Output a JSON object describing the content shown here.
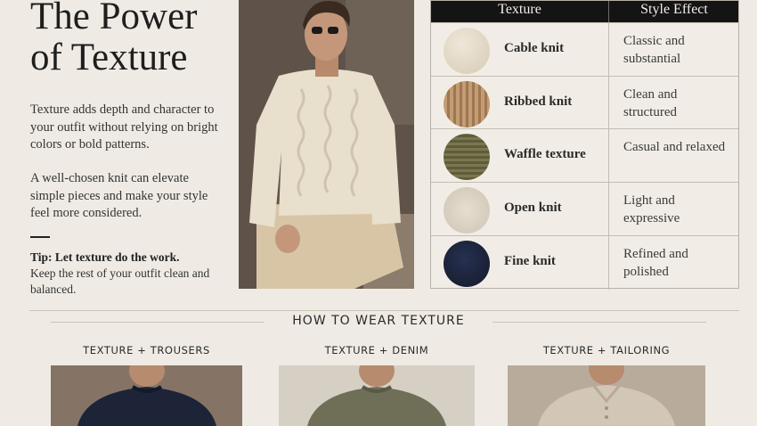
{
  "heading": {
    "line1": "The Power",
    "line2": "of Texture"
  },
  "intro": {
    "p1": "Texture adds depth and character to your outfit without relying on bright colors or bold patterns.",
    "p2": "A well-chosen knit can elevate simple pieces and make your style feel more considered."
  },
  "tip": {
    "label": "Tip: Let texture do the work.",
    "text": "Keep the rest of your outfit clean and balanced."
  },
  "table": {
    "header": {
      "col1": "Texture",
      "col2": "Style Effect"
    },
    "rows": [
      {
        "name": "Cable knit",
        "effect": "Classic and substantial",
        "swatch_color": "#e2d8c6"
      },
      {
        "name": "Ribbed knit",
        "effect": "Clean and structured",
        "swatch_color": "#b58d66"
      },
      {
        "name": "Waffle texture",
        "effect": "Casual and relaxed",
        "swatch_color": "#6e6a45"
      },
      {
        "name": "Open knit",
        "effect": "Light and expressive",
        "swatch_color": "#ddd3c5"
      },
      {
        "name": "Fine knit",
        "effect": "Refined and polished",
        "swatch_color": "#1b2235"
      }
    ]
  },
  "how_to": {
    "title": "HOW TO WEAR TEXTURE",
    "items": [
      {
        "label": "TEXTURE + TROUSERS",
        "sweater_color": "#1d2438"
      },
      {
        "label": "TEXTURE + DENIM",
        "sweater_color": "#6f6e57"
      },
      {
        "label": "TEXTURE + TAILORING",
        "sweater_color": "#d2c6b6"
      }
    ]
  },
  "colors": {
    "background": "#efebe4",
    "table_header": "#141414",
    "text": "#222222"
  }
}
